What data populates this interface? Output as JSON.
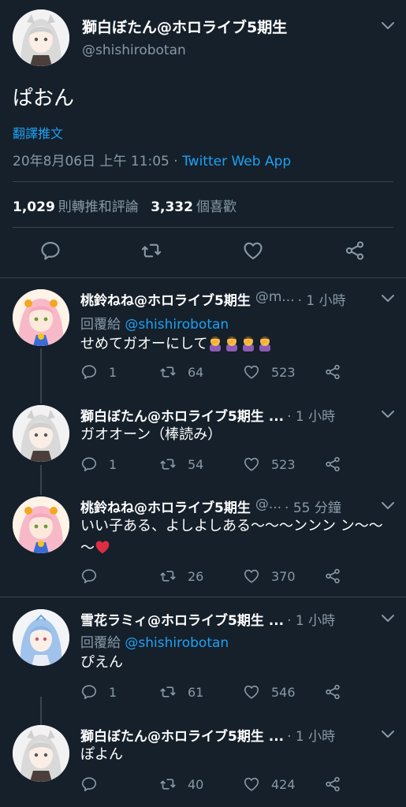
{
  "main": {
    "author_name": "獅白ぼたん@ホロライブ5期生",
    "author_handle": "@shishirobotan",
    "text": "ぱおん",
    "translate_label": "翻譯推文",
    "timestamp": "20年8月06日 上午 11:05",
    "separator": " · ",
    "source": "Twitter Web App",
    "retweets_count": "1,029",
    "retweets_label": "則轉推和評論",
    "likes_count": "3,332",
    "likes_label": "個喜歡"
  },
  "replies": [
    {
      "name": "桃鈴ねね@ホロライブ5期生",
      "handle": "@m...",
      "time": "· 1 小時",
      "reply_to_label": "回覆給",
      "reply_to_handle": "@shishirobotan",
      "text": "せめてガオーにして",
      "emoji": "facepalm x4",
      "replies": "1",
      "retweets": "64",
      "likes": "523",
      "avatar": "nene"
    },
    {
      "name": "獅白ぼたん@ホロライブ5期生 ...",
      "time": "· 1 小時",
      "text": "ガオオーン（棒読み）",
      "replies": "1",
      "retweets": "54",
      "likes": "523",
      "avatar": "botan"
    },
    {
      "name": "桃鈴ねね@ホロライブ5期生",
      "handle": "@...",
      "time": "· 55 分鐘",
      "text": "いい子ある、よしよしある～～～ンンン ン～～～",
      "emoji": "red heart",
      "replies": "",
      "retweets": "26",
      "likes": "370",
      "avatar": "nene"
    },
    {
      "name": "雪花ラミィ@ホロライブ5期生 ...",
      "time": "· 1 小時",
      "reply_to_label": "回覆給",
      "reply_to_handle": "@shishirobotan",
      "text": "ぴえん",
      "replies": "1",
      "retweets": "61",
      "likes": "546",
      "avatar": "lamy"
    },
    {
      "name": "獅白ぼたん@ホロライブ5期生 ...",
      "time": "· 1 小時",
      "text": "ぽよん",
      "replies": "",
      "retweets": "40",
      "likes": "424",
      "avatar": "botan"
    }
  ],
  "icons": [
    "chevron-down-icon",
    "reply-icon",
    "retweet-icon",
    "like-icon",
    "share-icon"
  ],
  "colors": {
    "background": "#15202b",
    "link": "#1da1f2",
    "muted": "#8899a6",
    "divider": "#38444d"
  }
}
